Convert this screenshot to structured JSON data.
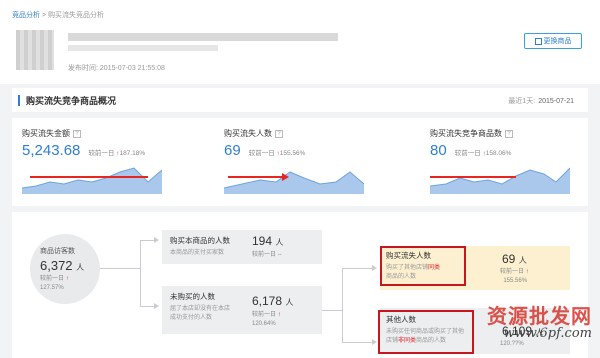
{
  "breadcrumb": {
    "root": "竞品分析",
    "sep": " > ",
    "current": "购买流失竞品分析"
  },
  "header": {
    "publish_label": "发布时间:",
    "publish_time": "2015-07-03 21:55:08",
    "change_button": "更换商品"
  },
  "section": {
    "title": "购买流失竞争商品概况",
    "update_label": "最近1天:",
    "update_date": "2015-07-21"
  },
  "metrics": [
    {
      "label": "购买流失金额",
      "value": "5,243.68",
      "compare_label": "较前一日",
      "compare_value": "187.18%"
    },
    {
      "label": "购买流失人数",
      "value": "69",
      "compare_label": "较前一日",
      "compare_value": "155.56%"
    },
    {
      "label": "购买流失竞争商品数",
      "value": "80",
      "compare_label": "较前一日",
      "compare_value": "158.06%"
    }
  ],
  "flow": {
    "visitors": {
      "title": "商品访客数",
      "value": "6,372",
      "unit": "人",
      "compare_label": "较前一日",
      "compare_value": "127.57%"
    },
    "bought": {
      "title": "购买本商品的人数",
      "desc": "本商品的支付买家数",
      "value": "194",
      "unit": "人",
      "compare_label": "较前一日",
      "compare_value": "--"
    },
    "not_bought": {
      "title": "未购买的人数",
      "desc_line1": "屈了本店却没有在本店",
      "desc_line2": "成功支付的人数",
      "value": "6,178",
      "unit": "人",
      "compare_label": "较前一日",
      "compare_value": "120.64%"
    },
    "lost": {
      "title": "购买流失人数",
      "desc_line1": "购买了其他店铺",
      "desc_hl1": "同类",
      "desc_line2": "商品的人数",
      "value": "69",
      "unit": "人",
      "compare_label": "较前一日",
      "compare_value": "155.56%"
    },
    "other": {
      "title": "其他人数",
      "desc_line1": "未购买任何商品或购买了其他",
      "desc_line2": "店铺",
      "desc_hl2": "非同类",
      "desc_line3": "商品的人数",
      "value": "6,109",
      "unit": "人",
      "compare_value": "120.??%"
    }
  },
  "watermark": {
    "line1": "资源批发网",
    "line2": "www.6pf.com"
  },
  "colors": {
    "accent": "#2f7fd1",
    "red": "#e0262b",
    "highlight_box": "#c7161d",
    "lost_bg": "#fdf0d0"
  }
}
